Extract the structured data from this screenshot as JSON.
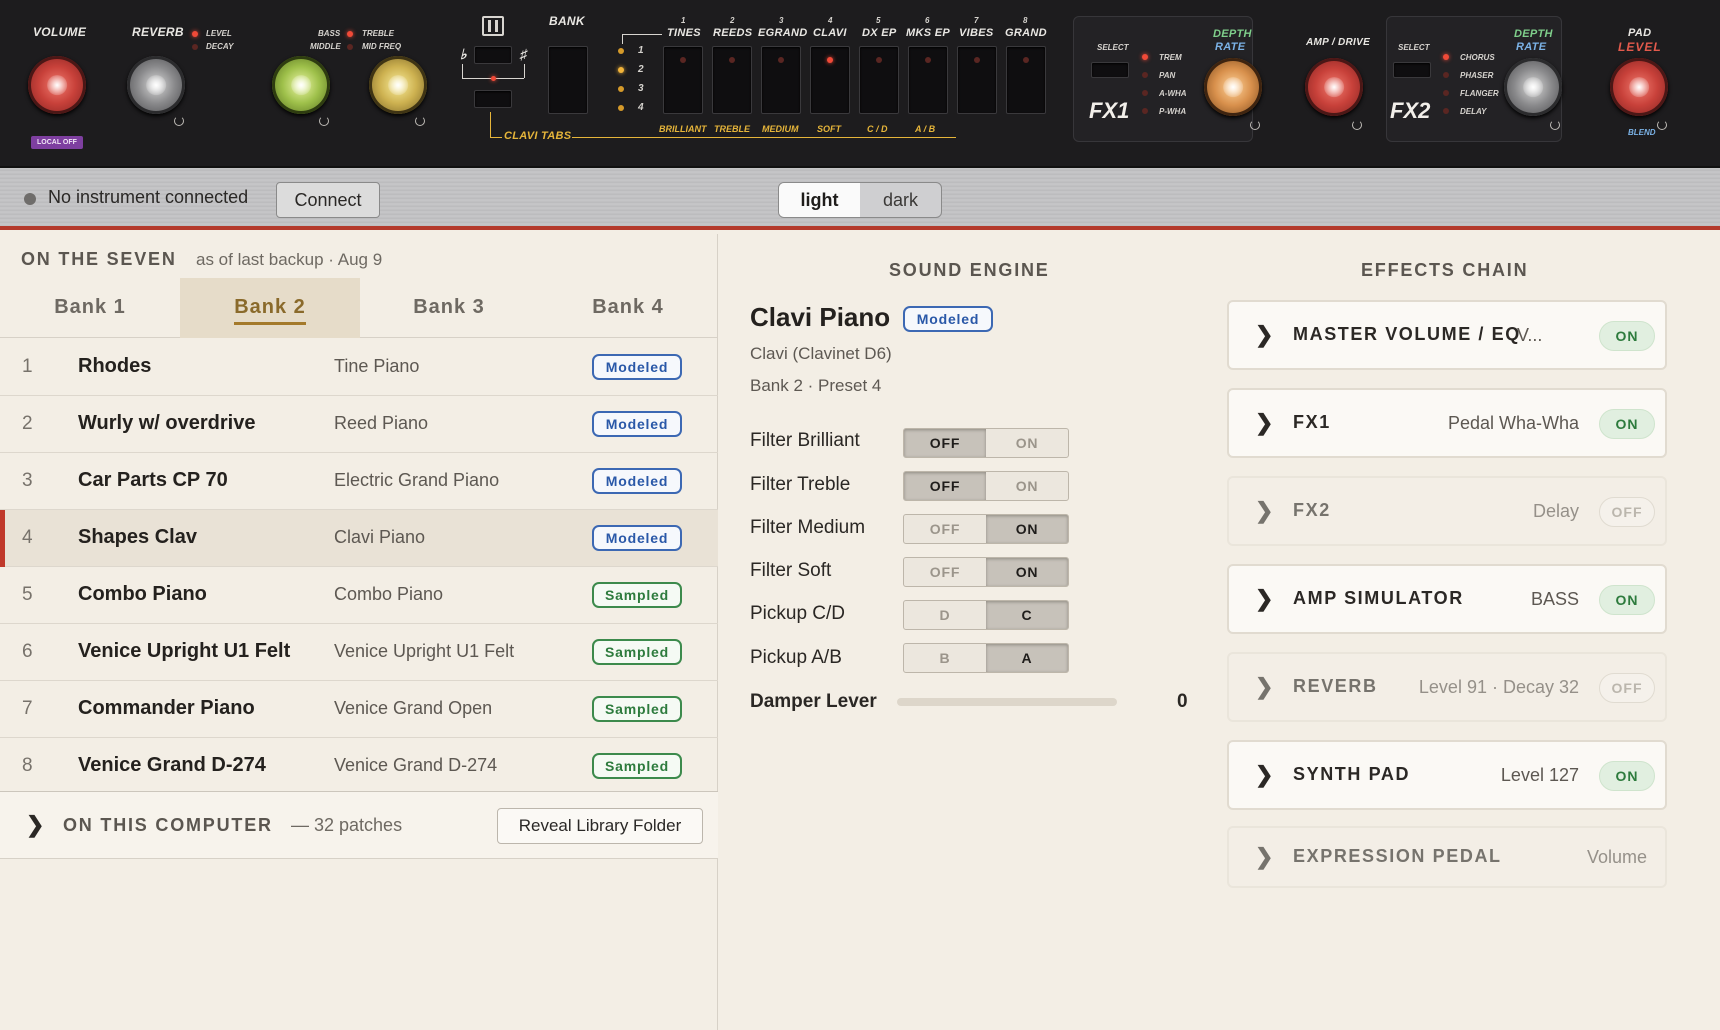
{
  "hardware": {
    "volume_label": "VOLUME",
    "local_off": "LOCAL OFF",
    "reverb_label": "REVERB",
    "reverb_level": "LEVEL",
    "reverb_decay": "DECAY",
    "eq_bass": "BASS",
    "eq_middle": "MIDDLE",
    "eq_treble": "TREBLE",
    "eq_midfreq": "MID FREQ",
    "bank_label": "BANK",
    "flat": "♭",
    "sharp": "♯",
    "bank_numbers": [
      "1",
      "2",
      "3",
      "4"
    ],
    "clavi_tabs": "CLAVI TABS",
    "instruments": [
      {
        "num": "1",
        "name": "TINES"
      },
      {
        "num": "2",
        "name": "REEDS"
      },
      {
        "num": "3",
        "name": "EGRAND"
      },
      {
        "num": "4",
        "name": "CLAVI"
      },
      {
        "num": "5",
        "name": "DX EP"
      },
      {
        "num": "6",
        "name": "MKS EP"
      },
      {
        "num": "7",
        "name": "VIBES"
      },
      {
        "num": "8",
        "name": "GRAND"
      }
    ],
    "tab_labels": [
      "BRILLIANT",
      "TREBLE",
      "MEDIUM",
      "SOFT",
      "C / D",
      "A / B"
    ],
    "fx1": {
      "select": "SELECT",
      "name": "FX1",
      "options": [
        "TREM",
        "PAN",
        "A-WHA",
        "P-WHA"
      ],
      "depth": "DEPTH",
      "rate": "RATE"
    },
    "amp_drive": "AMP / DRIVE",
    "fx2": {
      "select": "SELECT",
      "name": "FX2",
      "options": [
        "CHORUS",
        "PHASER",
        "FLANGER",
        "DELAY"
      ],
      "depth": "DEPTH",
      "rate": "RATE"
    },
    "pad": "PAD",
    "pad_level": "LEVEL",
    "pad_blend": "BLEND"
  },
  "status": {
    "connection": "No instrument connected",
    "connect_button": "Connect",
    "theme_light": "light",
    "theme_dark": "dark"
  },
  "library": {
    "heading": "ON THE SEVEN",
    "subheading": "as of last backup · Aug 9",
    "banks": [
      "Bank 1",
      "Bank 2",
      "Bank 3",
      "Bank 4"
    ],
    "active_bank": 1,
    "presets": [
      {
        "num": "1",
        "name": "Rhodes",
        "type": "Tine Piano",
        "badge": "Modeled"
      },
      {
        "num": "2",
        "name": "Wurly w/ overdrive",
        "type": "Reed Piano",
        "badge": "Modeled"
      },
      {
        "num": "3",
        "name": "Car Parts CP 70",
        "type": "Electric Grand Piano",
        "badge": "Modeled"
      },
      {
        "num": "4",
        "name": "Shapes Clav",
        "type": "Clavi Piano",
        "badge": "Modeled"
      },
      {
        "num": "5",
        "name": "Combo Piano",
        "type": "Combo Piano",
        "badge": "Sampled"
      },
      {
        "num": "6",
        "name": "Venice Upright U1 Felt",
        "type": "Venice Upright U1 Felt",
        "badge": "Sampled"
      },
      {
        "num": "7",
        "name": "Commander Piano",
        "type": "Venice Grand Open",
        "badge": "Sampled"
      },
      {
        "num": "8",
        "name": "Venice Grand D-274",
        "type": "Venice Grand D-274",
        "badge": "Sampled"
      }
    ],
    "selected_index": 3,
    "computer_heading": "ON THIS COMPUTER",
    "computer_count": "— 32 patches",
    "reveal_button": "Reveal Library Folder"
  },
  "engine": {
    "heading": "SOUND ENGINE",
    "title": "Clavi Piano",
    "badge": "Modeled",
    "model": "Clavi (Clavinet D6)",
    "location": "Bank 2 · Preset 4",
    "params": [
      {
        "label": "Filter Brilliant",
        "left": "OFF",
        "right": "ON",
        "selected": "left"
      },
      {
        "label": "Filter Treble",
        "left": "OFF",
        "right": "ON",
        "selected": "left"
      },
      {
        "label": "Filter Medium",
        "left": "OFF",
        "right": "ON",
        "selected": "right"
      },
      {
        "label": "Filter Soft",
        "left": "OFF",
        "right": "ON",
        "selected": "right"
      },
      {
        "label": "Pickup C/D",
        "left": "D",
        "right": "C",
        "selected": "right"
      },
      {
        "label": "Pickup A/B",
        "left": "B",
        "right": "A",
        "selected": "right"
      }
    ],
    "damper_label": "Damper Lever",
    "damper_value": "0"
  },
  "effects": {
    "heading": "EFFECTS CHAIN",
    "chain": [
      {
        "title": "MASTER VOLUME / EQ",
        "value": "V...",
        "state": "ON"
      },
      {
        "title": "FX1",
        "value": "Pedal Wha-Wha",
        "state": "ON"
      },
      {
        "title": "FX2",
        "value": "Delay",
        "state": "OFF"
      },
      {
        "title": "AMP SIMULATOR",
        "value": "BASS",
        "state": "ON"
      },
      {
        "title": "REVERB",
        "value": "Level 91 · Decay 32",
        "state": "OFF"
      },
      {
        "title": "SYNTH PAD",
        "value": "Level 127",
        "state": "ON"
      },
      {
        "title": "EXPRESSION PEDAL",
        "value": "Volume",
        "state": ""
      }
    ]
  },
  "colors": {
    "accent_red": "#b43a2c",
    "modeled_blue": "#3c68b3",
    "sampled_green": "#3c8a4c",
    "bank_active_gold": "#a47a2b"
  }
}
